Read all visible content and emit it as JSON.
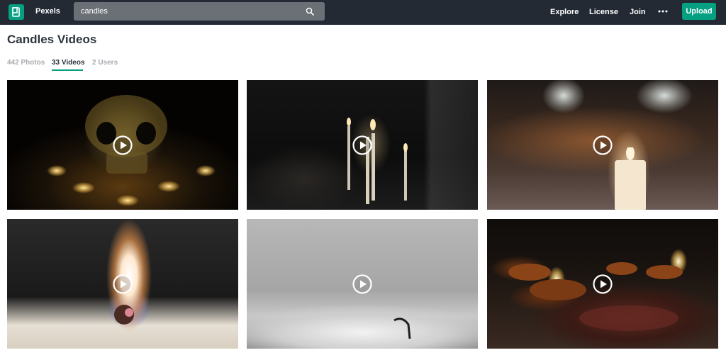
{
  "navbar": {
    "brand": "Pexels",
    "search": {
      "value": "candles"
    },
    "links": {
      "explore": "Explore",
      "license": "License",
      "join": "Join"
    },
    "upload_label": "Upload",
    "accent": "#05a081",
    "background": "#232a34"
  },
  "page": {
    "title": "Candles Videos"
  },
  "tabs": [
    {
      "label": "442 Photos",
      "active": false
    },
    {
      "label": "33 Videos",
      "active": true
    },
    {
      "label": "2 Users",
      "active": false
    }
  ],
  "icons": {
    "logo": "pexels-logo-icon",
    "search": "search-icon",
    "more": "more-horizontal-icon",
    "play": "play-icon"
  },
  "videos": [
    {
      "scene": "skull-with-tea-lights"
    },
    {
      "scene": "lighting-candles-in-dark"
    },
    {
      "scene": "candle-lit-street-festival"
    },
    {
      "scene": "candle-flame-close-up"
    },
    {
      "scene": "candle-wick-macro"
    },
    {
      "scene": "diya-oil-lamps"
    }
  ]
}
